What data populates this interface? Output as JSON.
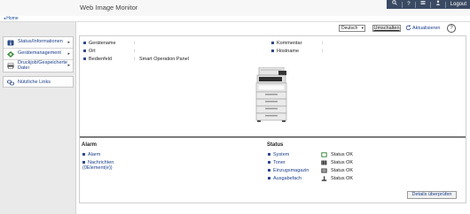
{
  "header": {
    "title": "Web Image Monitor",
    "logout": "Logout"
  },
  "breadcrumb": {
    "home": "Home"
  },
  "sidebar": {
    "items": [
      {
        "label": "Status/Informationen"
      },
      {
        "label": "Gerätemanagement"
      },
      {
        "label": "Druckjob/Gespeicherte Datei"
      }
    ],
    "links": {
      "label": "Nützliche Links"
    }
  },
  "toolbar": {
    "language": "Deutsch",
    "switch_label": "Umschalten",
    "refresh_label": "Aktualisieren"
  },
  "device_info": {
    "rows": [
      {
        "label": "Gerätename",
        "value": ""
      },
      {
        "label": "Ort",
        "value": ""
      },
      {
        "label": "Bedienfeld",
        "value": "Smart Operation Panel"
      },
      {
        "label": "Kommentar",
        "value": ""
      },
      {
        "label": "Hostname",
        "value": ""
      }
    ]
  },
  "alarm": {
    "title": "Alarm",
    "links": [
      "Alarm",
      "Nachrichten (0Element(e))"
    ]
  },
  "status": {
    "title": "Status",
    "rows": [
      {
        "label": "System",
        "value": "Status OK"
      },
      {
        "label": "Toner",
        "value": "Status OK"
      },
      {
        "label": "Einzugsmagazin",
        "value": "Status OK"
      },
      {
        "label": "Ausgabefach",
        "value": "Status OK"
      }
    ]
  },
  "details_button": "Details überprüfen",
  "colors": {
    "header_bar": "#3a4a63",
    "link": "#1a3f8c",
    "sidebar_bg": "#eaeaea"
  }
}
